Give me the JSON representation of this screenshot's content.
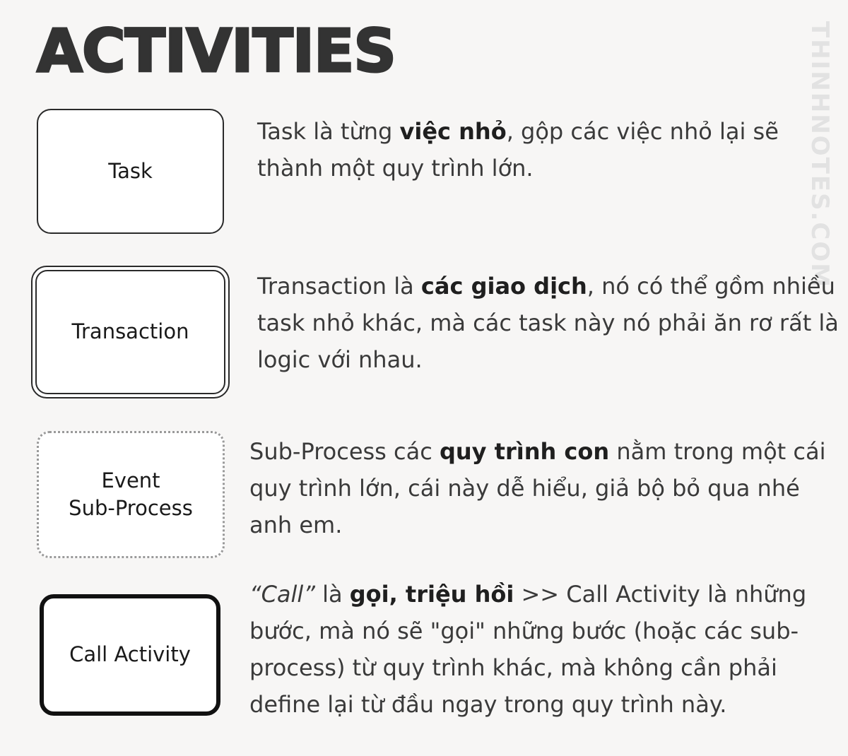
{
  "title": "ACTIVITIES",
  "watermark": "THINHNOTES.COM",
  "activities": [
    {
      "shape_label": "Task",
      "border_style": "single-solid",
      "description": [
        {
          "t": "Task là từng "
        },
        {
          "t": "việc nhỏ",
          "b": true
        },
        {
          "t": ", gộp các việc nhỏ lại sẽ thành một quy trình lớn."
        }
      ]
    },
    {
      "shape_label": "Transaction",
      "border_style": "double-solid",
      "description": [
        {
          "t": "Transaction là "
        },
        {
          "t": "các giao dịch",
          "b": true
        },
        {
          "t": ", nó có thể gồm nhiều task nhỏ khác, mà các task này nó phải ăn rơ rất là logic với nhau."
        }
      ]
    },
    {
      "shape_label": "Event\nSub-Process",
      "border_style": "dotted",
      "description": [
        {
          "t": "Sub-Process các "
        },
        {
          "t": "quy trình con",
          "b": true
        },
        {
          "t": " nằm trong một cái quy trình lớn, cái này dễ hiểu, giả bộ bỏ qua nhé anh em."
        }
      ]
    },
    {
      "shape_label": "Call Activity",
      "border_style": "thick-solid",
      "description": [
        {
          "t": "“Call”",
          "i": true
        },
        {
          "t": " là "
        },
        {
          "t": "gọi, triệu hồi",
          "b": true
        },
        {
          "t": " >> Call Activity là những bước, mà nó sẽ \"gọi\" những bước (hoặc các sub-process) từ quy trình khác, mà không cần phải define lại từ đầu ngay trong quy trình này."
        }
      ]
    }
  ],
  "colors": {
    "background": "#f7f6f5",
    "text": "#333333",
    "shape_border": "#2a2a2a",
    "dotted_border": "#9a9a9a",
    "watermark": "#e2e2e2"
  }
}
